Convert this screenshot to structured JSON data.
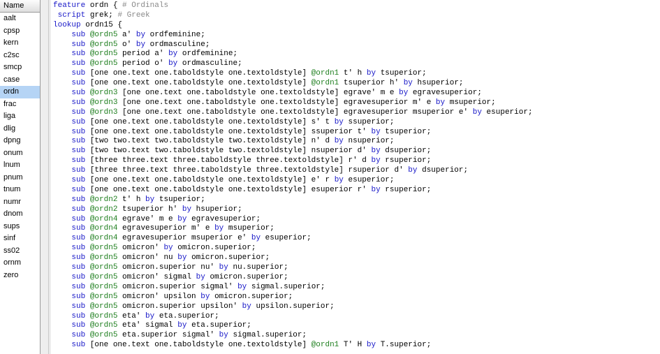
{
  "sidebar": {
    "header": "Name",
    "selected": "ordn",
    "items": [
      "aalt",
      "cpsp",
      "kern",
      "c2sc",
      "smcp",
      "case",
      "ordn",
      "frac",
      "liga",
      "dlig",
      "dpng",
      "onum",
      "lnum",
      "pnum",
      "tnum",
      "numr",
      "dnom",
      "sups",
      "sinf",
      "ss02",
      "ornm",
      "zero"
    ]
  },
  "colors": {
    "keyword": "#1818c8",
    "class": "#1f7f1f",
    "comment": "#8a8a8a",
    "selection": "#b5d4f5"
  },
  "code": {
    "lines": [
      [
        [
          "kw",
          "feature"
        ],
        [
          "t",
          " ordn { "
        ],
        [
          "cm",
          "# Ordinals"
        ]
      ],
      [
        [
          "t",
          " "
        ],
        [
          "kw",
          "script"
        ],
        [
          "t",
          " grek; "
        ],
        [
          "cm",
          "# Greek"
        ]
      ],
      [
        [
          "kw",
          "lookup"
        ],
        [
          "t",
          " ordn15 {"
        ]
      ],
      [
        [
          "t",
          "    "
        ],
        [
          "kw",
          "sub"
        ],
        [
          "t",
          " "
        ],
        [
          "cl",
          "@ordn5"
        ],
        [
          "t",
          " a' "
        ],
        [
          "kw",
          "by"
        ],
        [
          "t",
          " ordfeminine;"
        ]
      ],
      [
        [
          "t",
          "    "
        ],
        [
          "kw",
          "sub"
        ],
        [
          "t",
          " "
        ],
        [
          "cl",
          "@ordn5"
        ],
        [
          "t",
          " o' "
        ],
        [
          "kw",
          "by"
        ],
        [
          "t",
          " ordmasculine;"
        ]
      ],
      [
        [
          "t",
          "    "
        ],
        [
          "kw",
          "sub"
        ],
        [
          "t",
          " "
        ],
        [
          "cl",
          "@ordn5"
        ],
        [
          "t",
          " period a' "
        ],
        [
          "kw",
          "by"
        ],
        [
          "t",
          " ordfeminine;"
        ]
      ],
      [
        [
          "t",
          "    "
        ],
        [
          "kw",
          "sub"
        ],
        [
          "t",
          " "
        ],
        [
          "cl",
          "@ordn5"
        ],
        [
          "t",
          " period o' "
        ],
        [
          "kw",
          "by"
        ],
        [
          "t",
          " ordmasculine;"
        ]
      ],
      [
        [
          "t",
          "    "
        ],
        [
          "kw",
          "sub"
        ],
        [
          "t",
          " [one one.text one.taboldstyle one.textoldstyle] "
        ],
        [
          "cl",
          "@ordn1"
        ],
        [
          "t",
          " t' h "
        ],
        [
          "kw",
          "by"
        ],
        [
          "t",
          " tsuperior;"
        ]
      ],
      [
        [
          "t",
          "    "
        ],
        [
          "kw",
          "sub"
        ],
        [
          "t",
          " [one one.text one.taboldstyle one.textoldstyle] "
        ],
        [
          "cl",
          "@ordn1"
        ],
        [
          "t",
          " tsuperior h' "
        ],
        [
          "kw",
          "by"
        ],
        [
          "t",
          " hsuperior;"
        ]
      ],
      [
        [
          "t",
          "    "
        ],
        [
          "kw",
          "sub"
        ],
        [
          "t",
          " "
        ],
        [
          "cl",
          "@ordn3"
        ],
        [
          "t",
          " [one one.text one.taboldstyle one.textoldstyle] egrave' m e "
        ],
        [
          "kw",
          "by"
        ],
        [
          "t",
          " egravesuperior;"
        ]
      ],
      [
        [
          "t",
          "    "
        ],
        [
          "kw",
          "sub"
        ],
        [
          "t",
          " "
        ],
        [
          "cl",
          "@ordn3"
        ],
        [
          "t",
          " [one one.text one.taboldstyle one.textoldstyle] egravesuperior m' e "
        ],
        [
          "kw",
          "by"
        ],
        [
          "t",
          " msuperior;"
        ]
      ],
      [
        [
          "t",
          "    "
        ],
        [
          "kw",
          "sub"
        ],
        [
          "t",
          " "
        ],
        [
          "cl",
          "@ordn3"
        ],
        [
          "t",
          " [one one.text one.taboldstyle one.textoldstyle] egravesuperior msuperior e' "
        ],
        [
          "kw",
          "by"
        ],
        [
          "t",
          " esuperior;"
        ]
      ],
      [
        [
          "t",
          "    "
        ],
        [
          "kw",
          "sub"
        ],
        [
          "t",
          " [one one.text one.taboldstyle one.textoldstyle] s' t "
        ],
        [
          "kw",
          "by"
        ],
        [
          "t",
          " ssuperior;"
        ]
      ],
      [
        [
          "t",
          "    "
        ],
        [
          "kw",
          "sub"
        ],
        [
          "t",
          " [one one.text one.taboldstyle one.textoldstyle] ssuperior t' "
        ],
        [
          "kw",
          "by"
        ],
        [
          "t",
          " tsuperior;"
        ]
      ],
      [
        [
          "t",
          "    "
        ],
        [
          "kw",
          "sub"
        ],
        [
          "t",
          " [two two.text two.taboldstyle two.textoldstyle] n' d "
        ],
        [
          "kw",
          "by"
        ],
        [
          "t",
          " nsuperior;"
        ]
      ],
      [
        [
          "t",
          "    "
        ],
        [
          "kw",
          "sub"
        ],
        [
          "t",
          " [two two.text two.taboldstyle two.textoldstyle] nsuperior d' "
        ],
        [
          "kw",
          "by"
        ],
        [
          "t",
          " dsuperior;"
        ]
      ],
      [
        [
          "t",
          "    "
        ],
        [
          "kw",
          "sub"
        ],
        [
          "t",
          " [three three.text three.taboldstyle three.textoldstyle] r' d "
        ],
        [
          "kw",
          "by"
        ],
        [
          "t",
          " rsuperior;"
        ]
      ],
      [
        [
          "t",
          "    "
        ],
        [
          "kw",
          "sub"
        ],
        [
          "t",
          " [three three.text three.taboldstyle three.textoldstyle] rsuperior d' "
        ],
        [
          "kw",
          "by"
        ],
        [
          "t",
          " dsuperior;"
        ]
      ],
      [
        [
          "t",
          "    "
        ],
        [
          "kw",
          "sub"
        ],
        [
          "t",
          " [one one.text one.taboldstyle one.textoldstyle] e' r "
        ],
        [
          "kw",
          "by"
        ],
        [
          "t",
          " esuperior;"
        ]
      ],
      [
        [
          "t",
          "    "
        ],
        [
          "kw",
          "sub"
        ],
        [
          "t",
          " [one one.text one.taboldstyle one.textoldstyle] esuperior r' "
        ],
        [
          "kw",
          "by"
        ],
        [
          "t",
          " rsuperior;"
        ]
      ],
      [
        [
          "t",
          "    "
        ],
        [
          "kw",
          "sub"
        ],
        [
          "t",
          " "
        ],
        [
          "cl",
          "@ordn2"
        ],
        [
          "t",
          " t' h "
        ],
        [
          "kw",
          "by"
        ],
        [
          "t",
          " tsuperior;"
        ]
      ],
      [
        [
          "t",
          "    "
        ],
        [
          "kw",
          "sub"
        ],
        [
          "t",
          " "
        ],
        [
          "cl",
          "@ordn2"
        ],
        [
          "t",
          " tsuperior h' "
        ],
        [
          "kw",
          "by"
        ],
        [
          "t",
          " hsuperior;"
        ]
      ],
      [
        [
          "t",
          "    "
        ],
        [
          "kw",
          "sub"
        ],
        [
          "t",
          " "
        ],
        [
          "cl",
          "@ordn4"
        ],
        [
          "t",
          " egrave' m e "
        ],
        [
          "kw",
          "by"
        ],
        [
          "t",
          " egravesuperior;"
        ]
      ],
      [
        [
          "t",
          "    "
        ],
        [
          "kw",
          "sub"
        ],
        [
          "t",
          " "
        ],
        [
          "cl",
          "@ordn4"
        ],
        [
          "t",
          " egravesuperior m' e "
        ],
        [
          "kw",
          "by"
        ],
        [
          "t",
          " msuperior;"
        ]
      ],
      [
        [
          "t",
          "    "
        ],
        [
          "kw",
          "sub"
        ],
        [
          "t",
          " "
        ],
        [
          "cl",
          "@ordn4"
        ],
        [
          "t",
          " egravesuperior msuperior e' "
        ],
        [
          "kw",
          "by"
        ],
        [
          "t",
          " esuperior;"
        ]
      ],
      [
        [
          "t",
          "    "
        ],
        [
          "kw",
          "sub"
        ],
        [
          "t",
          " "
        ],
        [
          "cl",
          "@ordn5"
        ],
        [
          "t",
          " omicron' "
        ],
        [
          "kw",
          "by"
        ],
        [
          "t",
          " omicron.superior;"
        ]
      ],
      [
        [
          "t",
          "    "
        ],
        [
          "kw",
          "sub"
        ],
        [
          "t",
          " "
        ],
        [
          "cl",
          "@ordn5"
        ],
        [
          "t",
          " omicron' nu "
        ],
        [
          "kw",
          "by"
        ],
        [
          "t",
          " omicron.superior;"
        ]
      ],
      [
        [
          "t",
          "    "
        ],
        [
          "kw",
          "sub"
        ],
        [
          "t",
          " "
        ],
        [
          "cl",
          "@ordn5"
        ],
        [
          "t",
          " omicron.superior nu' "
        ],
        [
          "kw",
          "by"
        ],
        [
          "t",
          " nu.superior;"
        ]
      ],
      [
        [
          "t",
          "    "
        ],
        [
          "kw",
          "sub"
        ],
        [
          "t",
          " "
        ],
        [
          "cl",
          "@ordn5"
        ],
        [
          "t",
          " omicron' sigmal "
        ],
        [
          "kw",
          "by"
        ],
        [
          "t",
          " omicron.superior;"
        ]
      ],
      [
        [
          "t",
          "    "
        ],
        [
          "kw",
          "sub"
        ],
        [
          "t",
          " "
        ],
        [
          "cl",
          "@ordn5"
        ],
        [
          "t",
          " omicron.superior sigmal' "
        ],
        [
          "kw",
          "by"
        ],
        [
          "t",
          " sigmal.superior;"
        ]
      ],
      [
        [
          "t",
          "    "
        ],
        [
          "kw",
          "sub"
        ],
        [
          "t",
          " "
        ],
        [
          "cl",
          "@ordn5"
        ],
        [
          "t",
          " omicron' upsilon "
        ],
        [
          "kw",
          "by"
        ],
        [
          "t",
          " omicron.superior;"
        ]
      ],
      [
        [
          "t",
          "    "
        ],
        [
          "kw",
          "sub"
        ],
        [
          "t",
          " "
        ],
        [
          "cl",
          "@ordn5"
        ],
        [
          "t",
          " omicron.superior upsilon' "
        ],
        [
          "kw",
          "by"
        ],
        [
          "t",
          " upsilon.superior;"
        ]
      ],
      [
        [
          "t",
          "    "
        ],
        [
          "kw",
          "sub"
        ],
        [
          "t",
          " "
        ],
        [
          "cl",
          "@ordn5"
        ],
        [
          "t",
          " eta' "
        ],
        [
          "kw",
          "by"
        ],
        [
          "t",
          " eta.superior;"
        ]
      ],
      [
        [
          "t",
          "    "
        ],
        [
          "kw",
          "sub"
        ],
        [
          "t",
          " "
        ],
        [
          "cl",
          "@ordn5"
        ],
        [
          "t",
          " eta' sigmal "
        ],
        [
          "kw",
          "by"
        ],
        [
          "t",
          " eta.superior;"
        ]
      ],
      [
        [
          "t",
          "    "
        ],
        [
          "kw",
          "sub"
        ],
        [
          "t",
          " "
        ],
        [
          "cl",
          "@ordn5"
        ],
        [
          "t",
          " eta.superior sigmal' "
        ],
        [
          "kw",
          "by"
        ],
        [
          "t",
          " sigmal.superior;"
        ]
      ],
      [
        [
          "t",
          "    "
        ],
        [
          "kw",
          "sub"
        ],
        [
          "t",
          " [one one.text one.taboldstyle one.textoldstyle] "
        ],
        [
          "cl",
          "@ordn1"
        ],
        [
          "t",
          " T' H "
        ],
        [
          "kw",
          "by"
        ],
        [
          "t",
          " T.superior;"
        ]
      ]
    ]
  }
}
